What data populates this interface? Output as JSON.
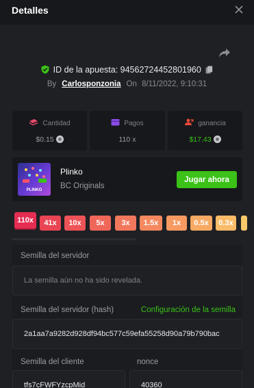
{
  "header": {
    "title": "Detalles"
  },
  "bet": {
    "id_label": "ID de la apuesta:",
    "id_value": "94562724452801960",
    "by_label": "By",
    "username": "Carlosponzonia",
    "on_label": "On",
    "datetime": "8/11/2022, 9:10:31"
  },
  "stats": {
    "amount": {
      "label": "Cantidad",
      "value": "$0.15"
    },
    "payout": {
      "label": "Pagos",
      "value": "110 x"
    },
    "profit": {
      "label": "ganancia",
      "value": "$17.43"
    }
  },
  "game": {
    "name": "Plinko",
    "provider": "BC Originals",
    "play_label": "Jugar ahora",
    "thumb_text": "PLINKO"
  },
  "multipliers": [
    {
      "label": "110x",
      "color": "#e52d52",
      "selected": true
    },
    {
      "label": "41x",
      "color": "#e94554"
    },
    {
      "label": "10x",
      "color": "#ed5357"
    },
    {
      "label": "5x",
      "color": "#f0675a"
    },
    {
      "label": "3x",
      "color": "#f2785d"
    },
    {
      "label": "1.5x",
      "color": "#f4895f"
    },
    {
      "label": "1x",
      "color": "#f69a61"
    },
    {
      "label": "0.5x",
      "color": "#f7aa64"
    },
    {
      "label": "0.3x",
      "color": "#f8bb67"
    },
    {
      "label": "",
      "color": "#f9c86a"
    }
  ],
  "server_seed": {
    "label": "Semilla del servidor",
    "value": "La semilla aún no ha sido revelada."
  },
  "server_seed_hash": {
    "label": "Semilla del servidor (hash)",
    "config_link": "Configuración de la semilla",
    "value": "2a1aa7a9282d928df94bc577c59efa55258d90a79b790bac"
  },
  "client_seed": {
    "label": "Semilla del cliente",
    "value": "tfs7cFWFYzcpMid"
  },
  "nonce": {
    "label": "nonce",
    "value": "40360"
  },
  "colors": {
    "accent": "#3bc117",
    "bg": "#1e2024",
    "panel": "#17181b"
  }
}
